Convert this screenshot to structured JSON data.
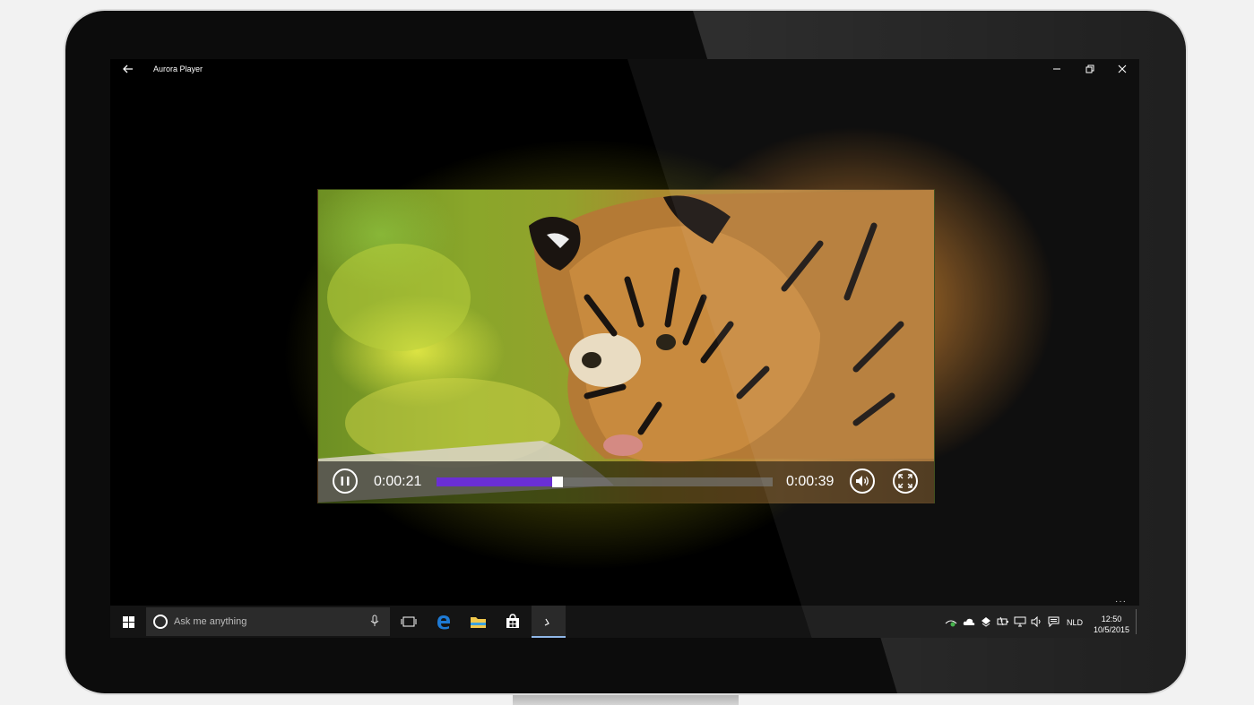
{
  "window": {
    "title": "Aurora Player"
  },
  "player": {
    "current_time": "0:00:21",
    "total_time": "0:00:39",
    "progress": 0.36
  },
  "taskbar": {
    "search_placeholder": "Ask me anything",
    "language": "NLD",
    "time": "12:50",
    "date": "10/5/2015",
    "more": "···"
  },
  "colors": {
    "accent_progress": "#6a2fd4",
    "taskbar_active": "#8fb7e8",
    "edge_blue": "#1e7ad4",
    "folder_yellow": "#f2c94c"
  },
  "icons": [
    "back-arrow-icon",
    "minimize-icon",
    "restore-icon",
    "close-icon",
    "pause-icon",
    "volume-icon",
    "fullscreen-icon",
    "windows-logo-icon",
    "cortana-circle-icon",
    "microphone-icon",
    "task-view-icon",
    "edge-browser-icon",
    "file-explorer-icon",
    "store-icon",
    "aurora-player-icon",
    "network-icon",
    "onedrive-cloud-icon",
    "dropbox-icon",
    "battery-icon",
    "wifi-icon",
    "speaker-icon",
    "action-center-icon"
  ]
}
